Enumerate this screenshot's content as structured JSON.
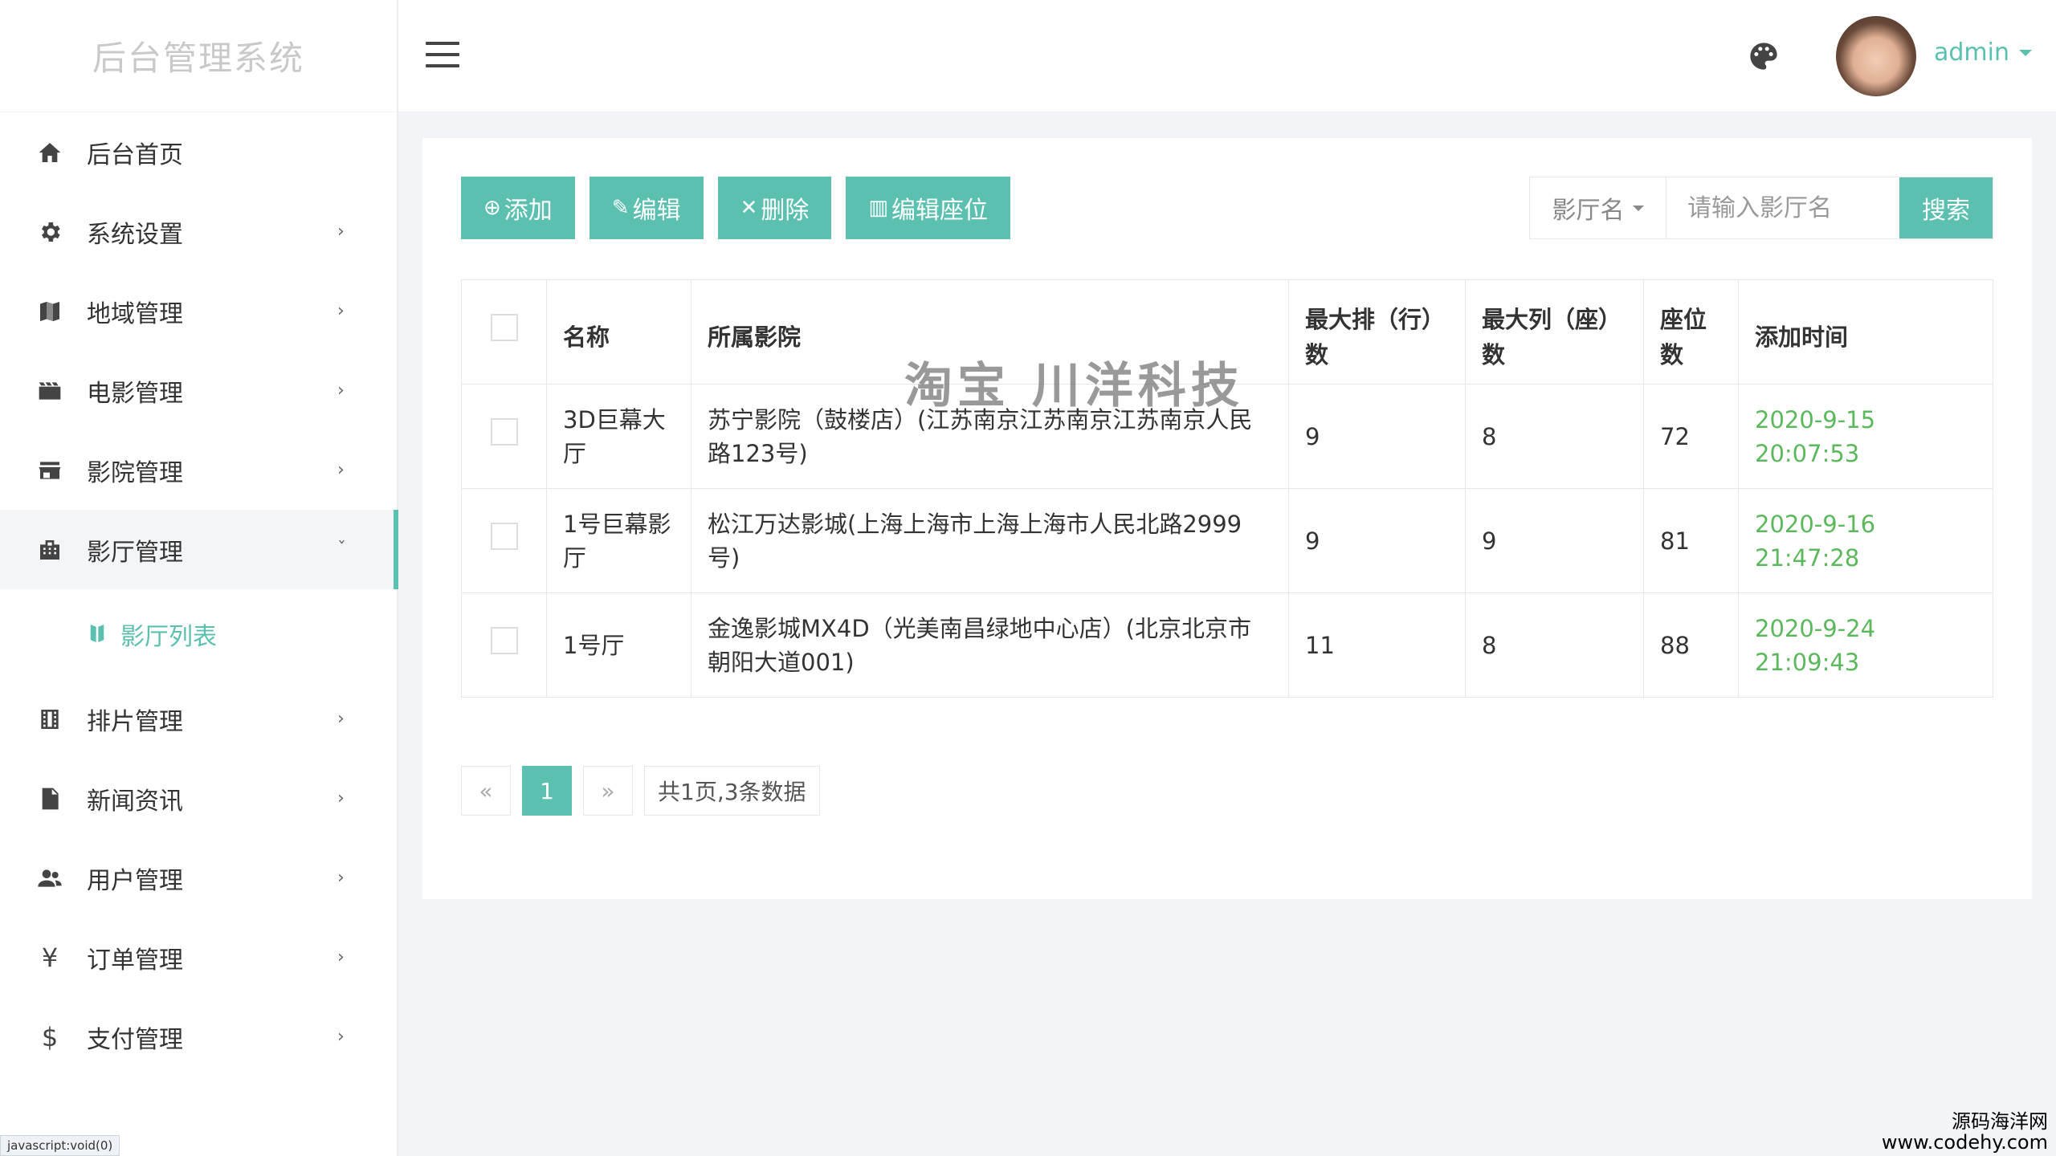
{
  "app": {
    "title": "后台管理系统"
  },
  "sidebar": {
    "items": [
      {
        "label": "后台首页",
        "icon": "home-icon",
        "has_children": false
      },
      {
        "label": "系统设置",
        "icon": "gear-icon",
        "has_children": true
      },
      {
        "label": "地域管理",
        "icon": "map-icon",
        "has_children": true
      },
      {
        "label": "电影管理",
        "icon": "film-icon",
        "has_children": true
      },
      {
        "label": "影院管理",
        "icon": "store-icon",
        "has_children": true
      },
      {
        "label": "影厅管理",
        "icon": "building-icon",
        "has_children": true,
        "expanded": true,
        "active": true
      },
      {
        "label": "排片管理",
        "icon": "schedule-icon",
        "has_children": true
      },
      {
        "label": "新闻资讯",
        "icon": "news-icon",
        "has_children": true
      },
      {
        "label": "用户管理",
        "icon": "users-icon",
        "has_children": true
      },
      {
        "label": "订单管理",
        "icon": "yen-icon",
        "has_children": true
      },
      {
        "label": "支付管理",
        "icon": "dollar-icon",
        "has_children": true
      }
    ],
    "submenu": {
      "label": "影厅列表",
      "icon": "hall-list-icon"
    }
  },
  "header": {
    "user": "admin"
  },
  "toolbar": {
    "add_label": "添加",
    "edit_label": "编辑",
    "delete_label": "删除",
    "edit_seats_label": "编辑座位"
  },
  "search": {
    "field": "影厅名",
    "placeholder": "请输入影厅名",
    "button": "搜索"
  },
  "table": {
    "headers": [
      "名称",
      "所属影院",
      "最大排（行）数",
      "最大列（座）数",
      "座位数",
      "添加时间"
    ],
    "rows": [
      {
        "name": "3D巨幕大厅",
        "cinema": "苏宁影院（鼓楼店）(江苏南京江苏南京江苏南京人民路123号)",
        "rows": "9",
        "cols": "8",
        "seats": "72",
        "time": "2020-9-15 20:07:53"
      },
      {
        "name": "1号巨幕影厅",
        "cinema": "松江万达影城(上海上海市上海上海市人民北路2999号)",
        "rows": "9",
        "cols": "9",
        "seats": "81",
        "time": "2020-9-16 21:47:28"
      },
      {
        "name": "1号厅",
        "cinema": "金逸影城MX4D（光美南昌绿地中心店）(北京北京市朝阳大道001)",
        "rows": "11",
        "cols": "8",
        "seats": "88",
        "time": "2020-9-24 21:09:43"
      }
    ]
  },
  "pagination": {
    "prev": "«",
    "current": "1",
    "next": "»",
    "info": "共1页,3条数据"
  },
  "overlays": {
    "watermark": "淘宝 川洋科技",
    "status_url": "javascript:void(0)",
    "site_line1": "源码海洋网",
    "site_line2": "www.codehy.com"
  },
  "colors": {
    "accent": "#5bc0b0",
    "time": "#5cb85c"
  }
}
